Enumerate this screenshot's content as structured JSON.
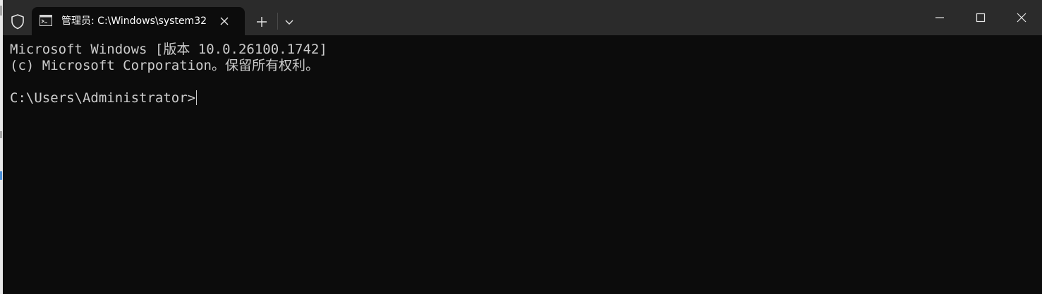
{
  "window": {
    "tab_title": "管理员: C:\\Windows\\system32"
  },
  "icons": {
    "shield": "shield-icon",
    "tab": "command-prompt-icon",
    "tab_close": "close-icon",
    "new_tab": "plus-icon",
    "dropdown": "chevron-down-icon",
    "minimize": "minimize-icon",
    "maximize": "maximize-icon",
    "close": "close-icon"
  },
  "terminal": {
    "lines": [
      "Microsoft Windows [版本 10.0.26100.1742]",
      "(c) Microsoft Corporation。保留所有权利。",
      "",
      "C:\\Users\\Administrator>"
    ]
  },
  "colors": {
    "titlebar": "#2b2b2b",
    "terminal_bg": "#0c0c0c",
    "terminal_fg": "#cccccc"
  }
}
